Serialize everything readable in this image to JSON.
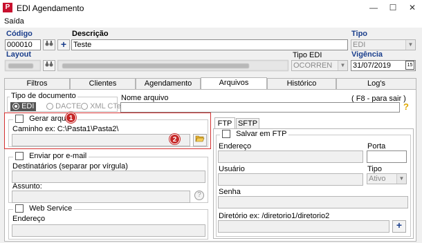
{
  "window": {
    "title": "EDI Agendamento",
    "app_icon": "P",
    "minimize": "—",
    "maximize": "☐",
    "close": "✕"
  },
  "menu": {
    "saida": "Saída"
  },
  "header": {
    "codigo_label": "Código",
    "codigo_value": "000010",
    "descricao_label": "Descrição",
    "descricao_value": "Teste",
    "tipo_label": "Tipo",
    "tipo_value": "EDI",
    "layout_label": "Layout",
    "tipo_edi_label": "Tipo EDI",
    "tipo_edi_value": "OCORREN",
    "vigencia_label": "Vigência",
    "vigencia_value": "31/07/2019"
  },
  "tabs": [
    "Filtros",
    "Clientes",
    "Agendamento",
    "Arquivos",
    "Histórico",
    "Log's"
  ],
  "active_tab": "Arquivos",
  "arquivos": {
    "tipo_documento_label": "Tipo de documento",
    "radio_edi": "EDI",
    "radio_dacte": "DACTE",
    "radio_xml": "XML CTe",
    "nome_arquivo_label": "Nome arquivo",
    "f8_hint": "( F8 - para sair )",
    "help_icon": "?",
    "gerar_arquivo_label": "Gerar arquivo",
    "caminho_label": "Caminho ex: C:\\Pasta1\\Pasta2\\",
    "badge1": "1",
    "badge2": "2",
    "enviar_email_label": "Enviar por e-mail",
    "destinatarios_label": "Destinatários (separar por vírgula)",
    "assunto_label": "Assunto:",
    "web_service_label": "Web Service",
    "endereco_ws_label": "Endereço",
    "ftp_tab": "FTP",
    "sftp_tab": "SFTP",
    "salvar_ftp_label": "Salvar em FTP",
    "endereco_label": "Endereço",
    "porta_label": "Porta",
    "usuario_label": "Usuário",
    "tipo_label": "Tipo",
    "tipo_value": "Ativo",
    "senha_label": "Senha",
    "diretorio_label": "Diretório ex: /diretorio1/diretorio2",
    "plus": "+"
  }
}
